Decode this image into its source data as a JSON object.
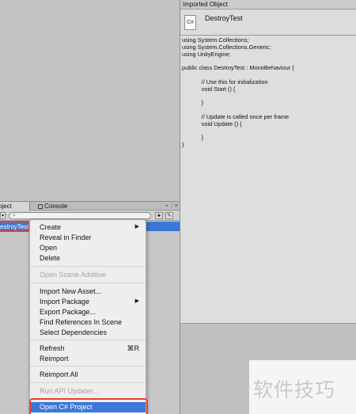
{
  "project_panel": {
    "tab_project": "oject",
    "tab_console": "Console",
    "search_placeholder": "",
    "selected_asset": "estroyTest"
  },
  "context_menu": {
    "items": [
      {
        "label": "Create",
        "submenu": true,
        "disabled": false
      },
      {
        "label": "Reveal in Finder",
        "disabled": false
      },
      {
        "label": "Open",
        "disabled": false
      },
      {
        "label": "Delete",
        "disabled": false
      },
      {
        "label": "Open Scene Additive",
        "disabled": true
      },
      {
        "label": "Import New Asset...",
        "disabled": false
      },
      {
        "label": "Import Package",
        "submenu": true,
        "disabled": false
      },
      {
        "label": "Export Package...",
        "disabled": false
      },
      {
        "label": "Find References In Scene",
        "disabled": false
      },
      {
        "label": "Select Dependencies",
        "disabled": false
      },
      {
        "label": "Refresh",
        "shortcut": "⌘R",
        "disabled": false
      },
      {
        "label": "Reimport",
        "disabled": false
      },
      {
        "label": "Reimport All",
        "disabled": false
      },
      {
        "label": "Run API Updater...",
        "disabled": true
      },
      {
        "label": "Open C# Project",
        "highlighted": true,
        "disabled": false
      }
    ]
  },
  "inspector": {
    "header": "Imported Object",
    "asset_name": "DestroyTest",
    "file_icon_text": "C#",
    "code_lines": [
      "using System.Collections;",
      "using System.Collections.Generic;",
      "using UnityEngine;",
      "",
      "public class DestroyTest : MonoBehaviour {",
      "",
      "            // Use this for initialization",
      "            void Start () {",
      "",
      "            }",
      "",
      "            // Update is called once per frame",
      "            void Update () {",
      "",
      "            }",
      "}"
    ]
  },
  "watermark": "软件技巧",
  "colors": {
    "selection": "#3a78d9",
    "highlight_box": "#e8412a"
  }
}
